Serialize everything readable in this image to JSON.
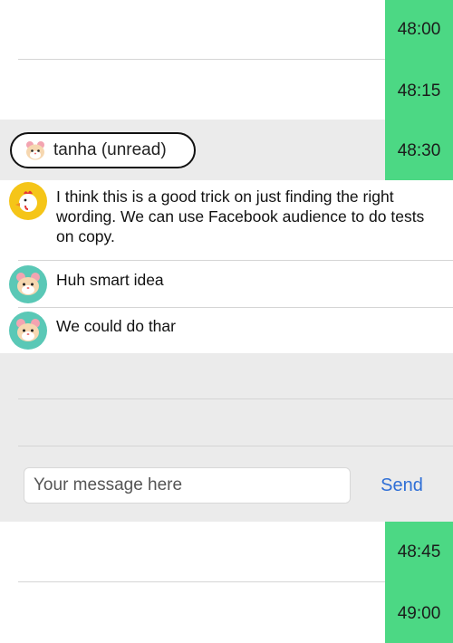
{
  "time_slots": [
    "48:00",
    "48:15",
    "48:30",
    "48:45",
    "49:00"
  ],
  "sender_pill": {
    "label": "tanha (unread)",
    "icon": "hamster-icon"
  },
  "messages": [
    {
      "avatar": "chicken-icon",
      "text": "I think this is a good trick on just finding the right wording. We can use Facebook audience to do tests on copy."
    },
    {
      "avatar": "hamster-icon",
      "text": "Huh smart idea"
    },
    {
      "avatar": "hamster-icon",
      "text": "We could do thar"
    }
  ],
  "composer": {
    "placeholder": "Your message here",
    "value": "",
    "send_label": "Send"
  },
  "colors": {
    "time_column": "#4cd884",
    "gray_area": "#ebebeb",
    "send_blue": "#2f6fd6",
    "chicken_bg": "#f5c518",
    "hamster_bg": "#5ac8b6"
  }
}
